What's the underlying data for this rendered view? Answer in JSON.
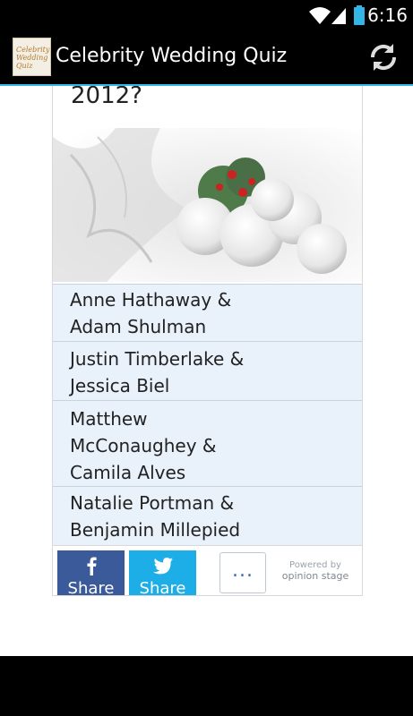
{
  "status_bar": {
    "time": "6:16"
  },
  "action_bar": {
    "title": "Celebrity Wedding Quiz",
    "logo_text": "Celebrity Wedding Quiz",
    "accent_color": "#33b5e5"
  },
  "quiz": {
    "question_fragment": "2012?",
    "image_alt": "white roses bouquet",
    "answers": [
      {
        "line1": "Anne Hathaway &",
        "line2": "Adam Shulman"
      },
      {
        "line1": "Justin Timberlake &",
        "line2": "Jessica Biel"
      },
      {
        "line1": "Matthew",
        "line2": "McConaughey &",
        "line3": "Camila Alves"
      },
      {
        "line1": "Natalie Portman &",
        "line2": "Benjamin Millepied"
      }
    ],
    "share": {
      "facebook_label": "Share",
      "twitter_label": "Share",
      "more_label": "...",
      "powered_by": "Powered by",
      "brand": "opinion stage"
    }
  },
  "colors": {
    "answer_bg": "#e9f1fb",
    "facebook": "#3b5a9a",
    "twitter": "#1daee8"
  }
}
